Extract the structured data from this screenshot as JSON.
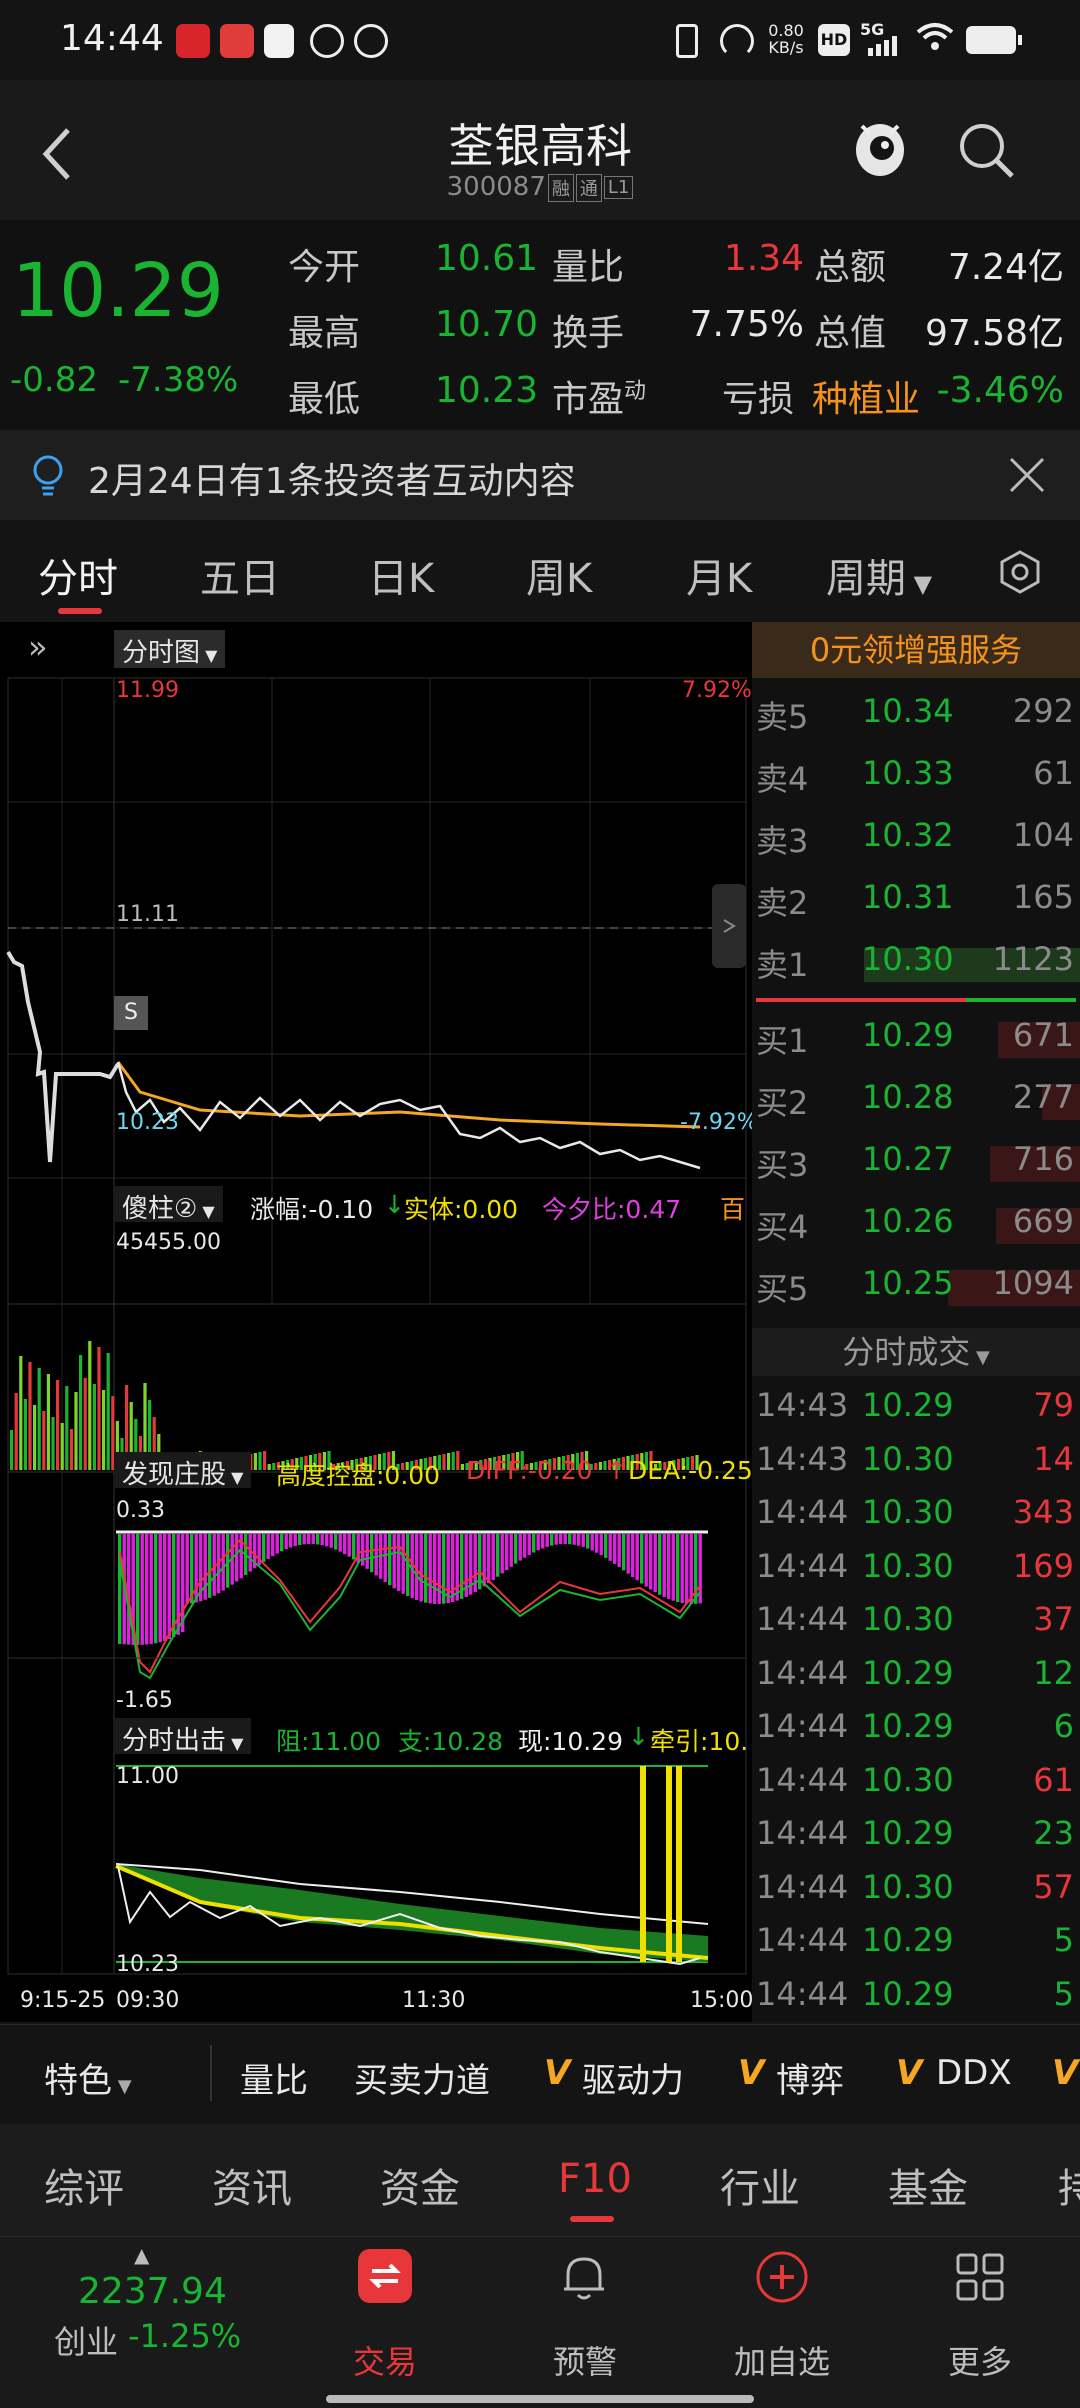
{
  "status_bar": {
    "time": "14:44",
    "net_speed": "0.80",
    "net_unit": "KB/s",
    "hd": "HD",
    "signal": "5G"
  },
  "header": {
    "title": "荃银高科",
    "code": "300087",
    "tags": [
      "融",
      "通",
      "L1"
    ]
  },
  "quote": {
    "price": "10.29",
    "change": "-0.82",
    "change_pct": "-7.38%",
    "fields": [
      {
        "label": "今开",
        "value": "10.61"
      },
      {
        "label": "最高",
        "value": "10.70"
      },
      {
        "label": "最低",
        "value": "10.23"
      },
      {
        "label": "量比",
        "value": "1.34"
      },
      {
        "label": "换手",
        "value": "7.75%"
      },
      {
        "label": "市盈",
        "value": "",
        "sup": "动"
      },
      {
        "label": "总额",
        "value": "7.24亿"
      },
      {
        "label": "总值",
        "value": "97.58亿"
      },
      {
        "label": "亏损",
        "value": ""
      }
    ],
    "sector": {
      "name": "种植业",
      "pct": "-3.46%"
    }
  },
  "notice": {
    "text": "2月24日有1条投资者互动内容"
  },
  "tabs": [
    "分时",
    "五日",
    "日K",
    "周K",
    "月K",
    "周期"
  ],
  "chart": {
    "chart_data": {
      "type": "line",
      "x_labels": [
        "9:15-25",
        "09:30",
        "11:30",
        "15:00"
      ],
      "price_high": "11.99",
      "price_mid": "11.11",
      "price_low": "10.23",
      "pct_high": "7.92%",
      "pct_low": "-7.92%",
      "s_marker": "S"
    },
    "dropdown": "分时图",
    "ind1": {
      "name": "傻柱②",
      "t1": "涨幅:-0.10",
      "t2": "实体:0.00",
      "t3": "今夕比:0.47",
      "t4": "百",
      "max": "45455.00"
    },
    "ind2": {
      "name": "发现庄股",
      "t1": "高度控盘:0.00",
      "t2": "DIFF:-0.20",
      "t3": "DEA:-0.25",
      "max": "0.33",
      "min": "-1.65"
    },
    "ind3": {
      "name": "分时出击",
      "t1": "阻:11.00",
      "t2": "支:10.28",
      "t3": "现:10.29",
      "t4": "牵引:10.",
      "max": "11.00",
      "min": "10.23"
    }
  },
  "book": {
    "promo": "0元领增强服务",
    "asks": [
      {
        "label": "卖5",
        "price": "10.34",
        "vol": "292"
      },
      {
        "label": "卖4",
        "price": "10.33",
        "vol": "61"
      },
      {
        "label": "卖3",
        "price": "10.32",
        "vol": "104"
      },
      {
        "label": "卖2",
        "price": "10.31",
        "vol": "165"
      },
      {
        "label": "卖1",
        "price": "10.30",
        "vol": "1123"
      }
    ],
    "bids": [
      {
        "label": "买1",
        "price": "10.29",
        "vol": "671"
      },
      {
        "label": "买2",
        "price": "10.28",
        "vol": "277"
      },
      {
        "label": "买3",
        "price": "10.27",
        "vol": "716"
      },
      {
        "label": "买4",
        "price": "10.26",
        "vol": "669"
      },
      {
        "label": "买5",
        "price": "10.25",
        "vol": "1094"
      }
    ],
    "trades_title": "分时成交",
    "trades": [
      {
        "t": "14:43",
        "p": "10.29",
        "v": "79",
        "c": "red"
      },
      {
        "t": "14:43",
        "p": "10.30",
        "v": "14",
        "c": "red"
      },
      {
        "t": "14:44",
        "p": "10.30",
        "v": "343",
        "c": "red"
      },
      {
        "t": "14:44",
        "p": "10.30",
        "v": "169",
        "c": "red"
      },
      {
        "t": "14:44",
        "p": "10.30",
        "v": "37",
        "c": "red"
      },
      {
        "t": "14:44",
        "p": "10.29",
        "v": "12",
        "c": "green"
      },
      {
        "t": "14:44",
        "p": "10.29",
        "v": "6",
        "c": "green"
      },
      {
        "t": "14:44",
        "p": "10.30",
        "v": "61",
        "c": "red"
      },
      {
        "t": "14:44",
        "p": "10.29",
        "v": "23",
        "c": "green"
      },
      {
        "t": "14:44",
        "p": "10.30",
        "v": "57",
        "c": "red"
      },
      {
        "t": "14:44",
        "p": "10.29",
        "v": "5",
        "c": "green"
      },
      {
        "t": "14:44",
        "p": "10.29",
        "v": "5",
        "c": "green"
      }
    ]
  },
  "features": {
    "special": "特色",
    "items": [
      "量比",
      "买卖力道",
      "驱动力",
      "博弈",
      "DDX",
      ""
    ]
  },
  "func_tabs": [
    "综评",
    "资讯",
    "资金",
    "F10",
    "行业",
    "基金",
    "持"
  ],
  "nav": {
    "index_value": "2237.94",
    "index_name": "创业",
    "index_pct": "-1.25%",
    "items": [
      "交易",
      "预警",
      "加自选",
      "更多"
    ]
  }
}
